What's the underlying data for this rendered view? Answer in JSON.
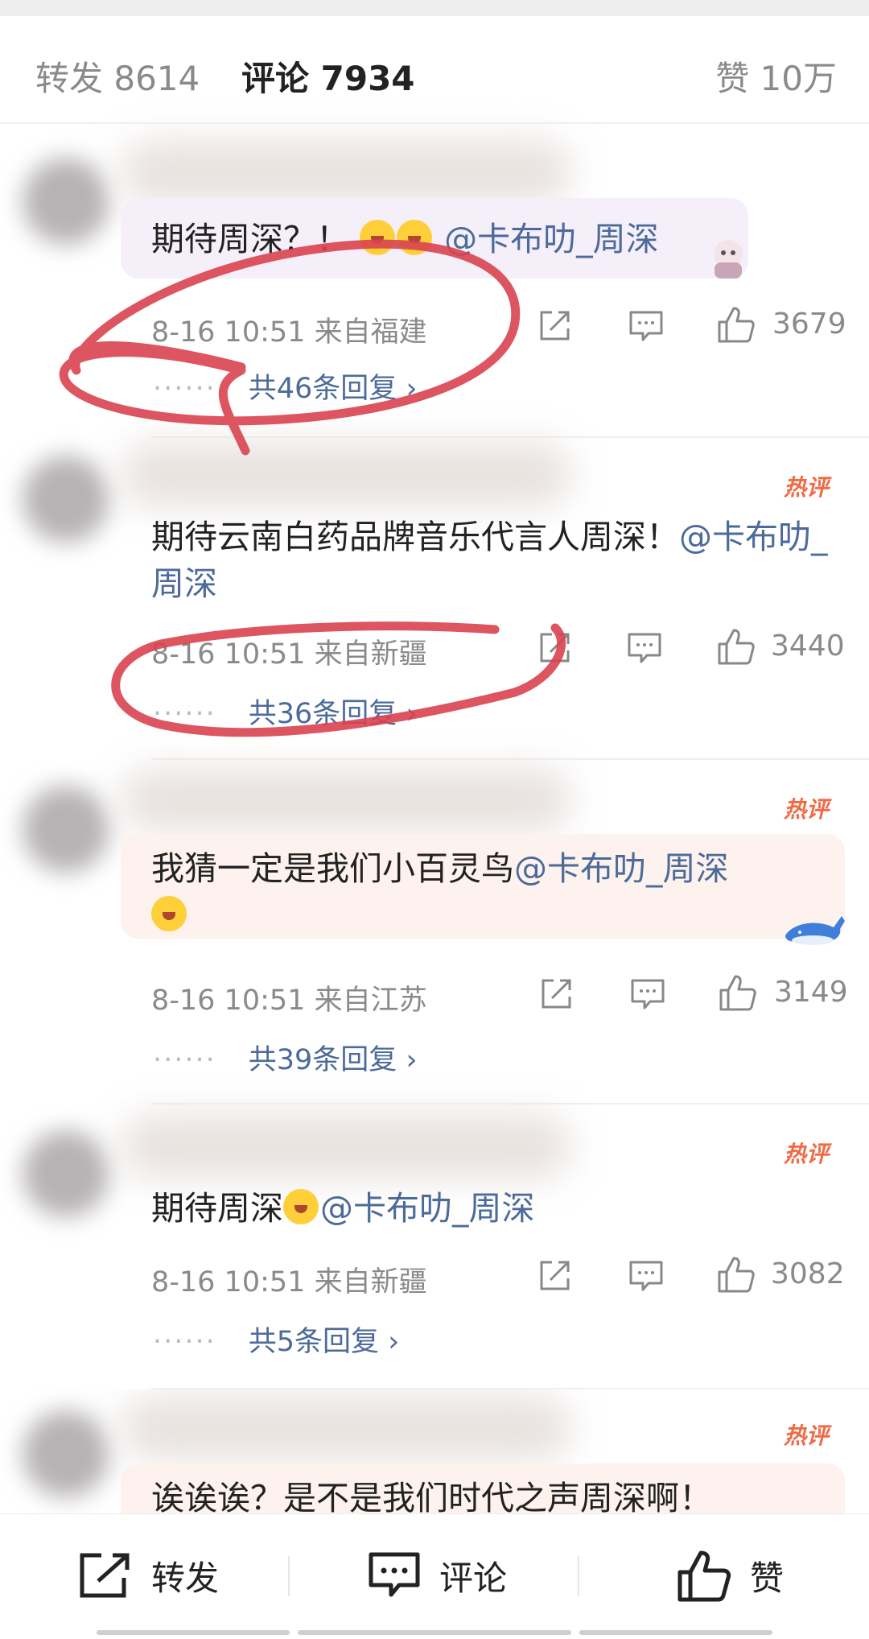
{
  "tabs": {
    "forward": "转发 8614",
    "comment": "评论 7934",
    "like": "赞 10万"
  },
  "hot_label": "热评",
  "comments": [
    {
      "text": "期待周深？！",
      "mention": "@卡布叻_周深",
      "time": "8-16 10:51",
      "location": "来自福建",
      "likes": "3679",
      "replies": "共46条回复",
      "dots": "······",
      "chevron": "›"
    },
    {
      "text": "期待云南白药品牌音乐代言人周深！",
      "mention": "@卡布叻_周深",
      "time": "8-16 10:51",
      "location": "来自新疆",
      "likes": "3440",
      "replies": "共36条回复",
      "dots": "······",
      "chevron": "›"
    },
    {
      "text": "我猜一定是我们小百灵鸟",
      "mention": "@卡布叻_周深",
      "time": "8-16 10:51",
      "location": "来自江苏",
      "likes": "3149",
      "replies": "共39条回复",
      "dots": "······",
      "chevron": "›"
    },
    {
      "text": "期待周深",
      "mention": "@卡布叻_周深",
      "time": "8-16 10:51",
      "location": "来自新疆",
      "likes": "3082",
      "replies": "共5条回复",
      "dots": "······",
      "chevron": "›"
    },
    {
      "text": "诶诶诶？是不是我们时代之声周深啊！"
    }
  ],
  "bottom_bar": {
    "forward": "转发",
    "comment": "评论",
    "like": "赞"
  },
  "colors": {
    "accent_link": "#4c6a9a",
    "hot": "#f06a46",
    "scribble": "#d9434f"
  },
  "icons": [
    "share-icon",
    "comment-icon",
    "thumbs-up-icon",
    "chevron-right-icon"
  ]
}
